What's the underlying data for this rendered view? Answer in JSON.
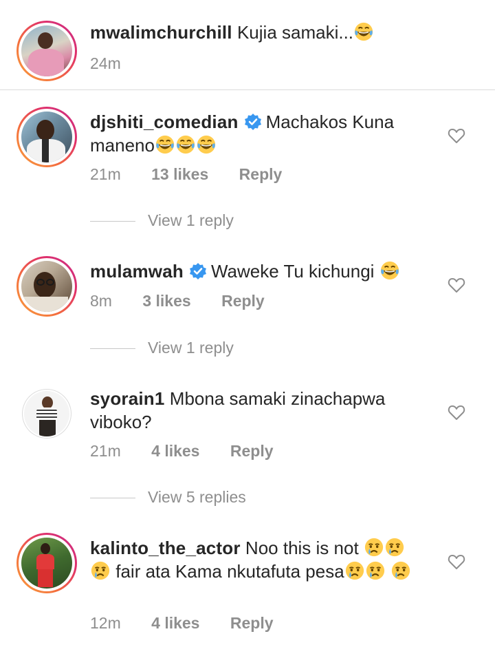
{
  "caption": {
    "username": "mwalimchurchill",
    "text": "Kujia samaki...",
    "emoji": "joy-emoji",
    "time": "24m"
  },
  "comments": [
    {
      "username": "djshiti_comedian",
      "verified": true,
      "text": "Machakos Kuna maneno",
      "emoji": "joy-emoji x3",
      "time": "21m",
      "likes": "13 likes",
      "reply": "Reply",
      "view_replies": "View 1 reply"
    },
    {
      "username": "mulamwah",
      "verified": true,
      "text": "Waweke Tu kichungi",
      "emoji": "joy-emoji",
      "time": "8m",
      "likes": "3 likes",
      "reply": "Reply",
      "view_replies": "View 1 reply"
    },
    {
      "username": "syorain1",
      "verified": false,
      "text": "Mbona samaki zinachapwa viboko?",
      "time": "21m",
      "likes": "4 likes",
      "reply": "Reply",
      "view_replies": "View 5 replies"
    },
    {
      "username": "kalinto_the_actor",
      "verified": false,
      "text_part1": "Noo this is not",
      "text_part2": "fair ata Kama nkutafuta pesa",
      "emoji": "crying-emoji",
      "time": "12m",
      "likes": "4 likes",
      "reply": "Reply"
    }
  ],
  "colors": {
    "text": "#262626",
    "meta": "#8e8e8e",
    "verified": "#3897f0",
    "divider": "#dbdbdb"
  },
  "icons": {
    "like": "heart-outline-icon",
    "verified": "verified-badge-icon"
  }
}
